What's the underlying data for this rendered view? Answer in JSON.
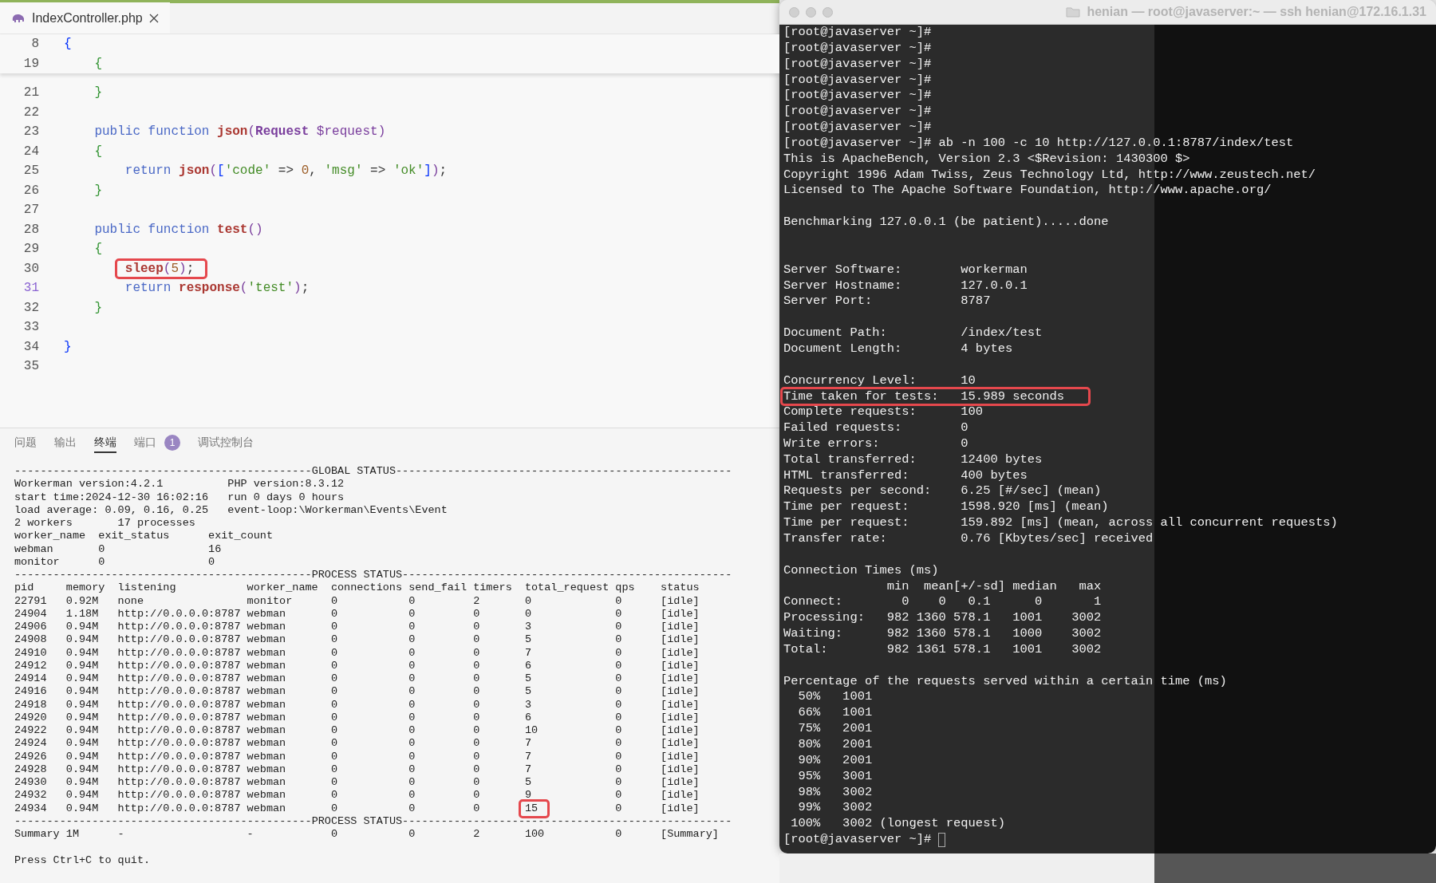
{
  "editor": {
    "tab": {
      "label": "IndexController.php",
      "selected": true
    },
    "sticky_lines": [
      {
        "number": "8",
        "current": false,
        "boxed": false,
        "tokens": [
          {
            "text": "{",
            "kind": "bracket_outer"
          }
        ]
      },
      {
        "number": "19",
        "current": false,
        "boxed": false,
        "tokens": [
          {
            "text": "    {",
            "kind": "bracket_inner"
          }
        ]
      }
    ],
    "lines": [
      {
        "number": "21",
        "current": false,
        "boxed": false,
        "tokens": [
          {
            "text": "    }",
            "kind": "bracket_inner"
          }
        ]
      },
      {
        "number": "22",
        "current": false,
        "boxed": false
      },
      {
        "number": "23",
        "current": false,
        "boxed": false,
        "tokens": [
          {
            "text": "    public function ",
            "kind": "keyword"
          },
          {
            "text": "json",
            "kind": "function"
          },
          {
            "text": "(",
            "kind": "paren"
          },
          {
            "text": "Request ",
            "kind": "type"
          },
          {
            "text": "$request",
            "kind": "variable"
          },
          {
            "text": ")",
            "kind": "paren"
          }
        ]
      },
      {
        "number": "24",
        "current": false,
        "boxed": false,
        "tokens": [
          {
            "text": "    {",
            "kind": "bracket_inner"
          }
        ]
      },
      {
        "number": "25",
        "current": false,
        "boxed": false,
        "tokens": [
          {
            "text": "        return ",
            "kind": "keyword"
          },
          {
            "text": "json",
            "kind": "function"
          },
          {
            "text": "(",
            "kind": "paren"
          },
          {
            "text": "[",
            "kind": "bracket_outer"
          },
          {
            "text": "'code'",
            "kind": "string"
          },
          {
            "text": " => ",
            "kind": "plain"
          },
          {
            "text": "0",
            "kind": "number"
          },
          {
            "text": ", ",
            "kind": "plain"
          },
          {
            "text": "'msg'",
            "kind": "string"
          },
          {
            "text": " => ",
            "kind": "plain"
          },
          {
            "text": "'ok'",
            "kind": "string"
          },
          {
            "text": "]",
            "kind": "bracket_outer"
          },
          {
            "text": ")",
            "kind": "paren"
          },
          {
            "text": ";",
            "kind": "plain"
          }
        ]
      },
      {
        "number": "26",
        "current": false,
        "boxed": false,
        "tokens": [
          {
            "text": "    }",
            "kind": "bracket_inner"
          }
        ]
      },
      {
        "number": "27",
        "current": false,
        "boxed": false
      },
      {
        "number": "28",
        "current": false,
        "boxed": false,
        "tokens": [
          {
            "text": "    public function ",
            "kind": "keyword"
          },
          {
            "text": "test",
            "kind": "function"
          },
          {
            "text": "()",
            "kind": "paren"
          }
        ]
      },
      {
        "number": "29",
        "current": false,
        "boxed": false,
        "tokens": [
          {
            "text": "    {",
            "kind": "bracket_inner"
          }
        ]
      },
      {
        "number": "30",
        "current": false,
        "boxed": true,
        "tokens": [
          {
            "text": "        sleep",
            "kind": "function"
          },
          {
            "text": "(",
            "kind": "paren"
          },
          {
            "text": "5",
            "kind": "number"
          },
          {
            "text": ")",
            "kind": "paren"
          },
          {
            "text": ";",
            "kind": "plain"
          }
        ]
      },
      {
        "number": "31",
        "current": true,
        "boxed": false,
        "tokens": [
          {
            "text": "        return ",
            "kind": "keyword"
          },
          {
            "text": "response",
            "kind": "function"
          },
          {
            "text": "(",
            "kind": "paren"
          },
          {
            "text": "'test'",
            "kind": "string"
          },
          {
            "text": ")",
            "kind": "paren"
          },
          {
            "text": ";",
            "kind": "plain"
          }
        ]
      },
      {
        "number": "32",
        "current": false,
        "boxed": false,
        "tokens": [
          {
            "text": "    }",
            "kind": "bracket_inner"
          }
        ]
      },
      {
        "number": "33",
        "current": false,
        "boxed": false
      },
      {
        "number": "34",
        "current": false,
        "boxed": false,
        "tokens": [
          {
            "text": "}",
            "kind": "bracket_outer"
          }
        ]
      },
      {
        "number": "35",
        "current": false,
        "boxed": false
      }
    ]
  },
  "panel": {
    "tabs": [
      {
        "label": "问题",
        "selected": false
      },
      {
        "label": "输出",
        "selected": false
      },
      {
        "label": "终端",
        "selected": true
      },
      {
        "label": "端口",
        "selected": false,
        "badge": "1"
      },
      {
        "label": "调试控制台",
        "selected": false
      }
    ],
    "terminal": {
      "global_rule": "----------------------------------------------GLOBAL STATUS----------------------------------------------------",
      "global_lines": [
        "Workerman version:4.2.1          PHP version:8.3.12",
        "start time:2024-12-30 16:02:16   run 0 days 0 hours",
        "load average: 0.09, 0.16, 0.25   event-loop:\\Workerman\\Events\\Event",
        "2 workers       17 processes",
        "worker_name  exit_status      exit_count",
        "webman       0                16",
        "monitor      0                0"
      ],
      "process_rule": "----------------------------------------------PROCESS STATUS---------------------------------------------------",
      "summary_rule": "----------------------------------------------PROCESS STATUS---------------------------------------------------",
      "columns": [
        "pid",
        "memory",
        "listening",
        "worker_name",
        "connections",
        "send_fail",
        "timers",
        "total_request",
        "qps",
        "status"
      ],
      "rows": [
        [
          "22791",
          "0.92M",
          "none",
          "monitor",
          "0",
          "0",
          "2",
          "0",
          "0",
          "[idle]"
        ],
        [
          "24904",
          "1.18M",
          "http://0.0.0.0:8787",
          "webman",
          "0",
          "0",
          "0",
          "0",
          "0",
          "[idle]"
        ],
        [
          "24906",
          "0.94M",
          "http://0.0.0.0:8787",
          "webman",
          "0",
          "0",
          "0",
          "3",
          "0",
          "[idle]"
        ],
        [
          "24908",
          "0.94M",
          "http://0.0.0.0:8787",
          "webman",
          "0",
          "0",
          "0",
          "5",
          "0",
          "[idle]"
        ],
        [
          "24910",
          "0.94M",
          "http://0.0.0.0:8787",
          "webman",
          "0",
          "0",
          "0",
          "7",
          "0",
          "[idle]"
        ],
        [
          "24912",
          "0.94M",
          "http://0.0.0.0:8787",
          "webman",
          "0",
          "0",
          "0",
          "6",
          "0",
          "[idle]"
        ],
        [
          "24914",
          "0.94M",
          "http://0.0.0.0:8787",
          "webman",
          "0",
          "0",
          "0",
          "5",
          "0",
          "[idle]"
        ],
        [
          "24916",
          "0.94M",
          "http://0.0.0.0:8787",
          "webman",
          "0",
          "0",
          "0",
          "5",
          "0",
          "[idle]"
        ],
        [
          "24918",
          "0.94M",
          "http://0.0.0.0:8787",
          "webman",
          "0",
          "0",
          "0",
          "3",
          "0",
          "[idle]"
        ],
        [
          "24920",
          "0.94M",
          "http://0.0.0.0:8787",
          "webman",
          "0",
          "0",
          "0",
          "6",
          "0",
          "[idle]"
        ],
        [
          "24922",
          "0.94M",
          "http://0.0.0.0:8787",
          "webman",
          "0",
          "0",
          "0",
          "10",
          "0",
          "[idle]"
        ],
        [
          "24924",
          "0.94M",
          "http://0.0.0.0:8787",
          "webman",
          "0",
          "0",
          "0",
          "7",
          "0",
          "[idle]"
        ],
        [
          "24926",
          "0.94M",
          "http://0.0.0.0:8787",
          "webman",
          "0",
          "0",
          "0",
          "7",
          "0",
          "[idle]"
        ],
        [
          "24928",
          "0.94M",
          "http://0.0.0.0:8787",
          "webman",
          "0",
          "0",
          "0",
          "7",
          "0",
          "[idle]"
        ],
        [
          "24930",
          "0.94M",
          "http://0.0.0.0:8787",
          "webman",
          "0",
          "0",
          "0",
          "5",
          "0",
          "[idle]"
        ],
        [
          "24932",
          "0.94M",
          "http://0.0.0.0:8787",
          "webman",
          "0",
          "0",
          "0",
          "9",
          "0",
          "[idle]"
        ],
        [
          "24934",
          "0.94M",
          "http://0.0.0.0:8787",
          "webman",
          "0",
          "0",
          "0",
          {
            "text": "15",
            "boxed": true
          },
          "0",
          "[idle]"
        ]
      ],
      "summary": [
        "Summary",
        "1M",
        "-",
        "-",
        "0",
        "0",
        "2",
        "100",
        "0",
        "[Summary]"
      ],
      "footer": "Press Ctrl+C to quit."
    }
  },
  "ssh_window": {
    "title": "henian — root@javaserver:~ — ssh henian@172.16.1.31",
    "blocks": [
      {
        "extra_gap": false,
        "lines": [
          "[root@javaserver ~]#",
          "[root@javaserver ~]#",
          "[root@javaserver ~]#",
          "[root@javaserver ~]#",
          "[root@javaserver ~]#",
          "[root@javaserver ~]#",
          "[root@javaserver ~]#",
          "[root@javaserver ~]# ab -n 100 -c 10 http://127.0.0.1:8787/index/test",
          "This is ApacheBench, Version 2.3 <$Revision: 1430300 $>",
          "Copyright 1996 Adam Twiss, Zeus Technology Ltd, http://www.zeustech.net/",
          "Licensed to The Apache Software Foundation, http://www.apache.org/"
        ]
      },
      {
        "extra_gap": false,
        "lines": [
          "Benchmarking 127.0.0.1 (be patient).....done"
        ]
      },
      {
        "extra_gap": true,
        "lines": [
          "Server Software:        workerman",
          "Server Hostname:        127.0.0.1",
          "Server Port:            8787"
        ]
      },
      {
        "extra_gap": false,
        "lines": [
          "Document Path:          /index/test",
          "Document Length:        4 bytes"
        ]
      },
      {
        "extra_gap": false,
        "lines": [
          "Concurrency Level:      10",
          {
            "text": "Time taken for tests:   15.989 seconds",
            "boxed": true
          },
          "Complete requests:      100",
          "Failed requests:        0",
          "Write errors:           0",
          "Total transferred:      12400 bytes",
          "HTML transferred:       400 bytes",
          "Requests per second:    6.25 [#/sec] (mean)",
          "Time per request:       1598.920 [ms] (mean)",
          "Time per request:       159.892 [ms] (mean, across all concurrent requests)",
          "Transfer rate:          0.76 [Kbytes/sec] received"
        ]
      },
      {
        "extra_gap": false,
        "lines": [
          "Connection Times (ms)",
          "              min  mean[+/-sd] median   max",
          "Connect:        0    0   0.1      0       1",
          "Processing:   982 1360 578.1   1001    3002",
          "Waiting:      982 1360 578.1   1000    3002",
          "Total:        982 1361 578.1   1001    3002"
        ]
      },
      {
        "extra_gap": false,
        "lines": [
          "Percentage of the requests served within a certain time (ms)",
          "  50%   1001",
          "  66%   1001",
          "  75%   2001",
          "  80%   2001",
          "  90%   2001",
          "  95%   3001",
          "  98%   3002",
          "  99%   3002",
          " 100%   3002 (longest request)",
          "[root@javaserver ~]#"
        ]
      }
    ],
    "cursor_visible": true
  }
}
